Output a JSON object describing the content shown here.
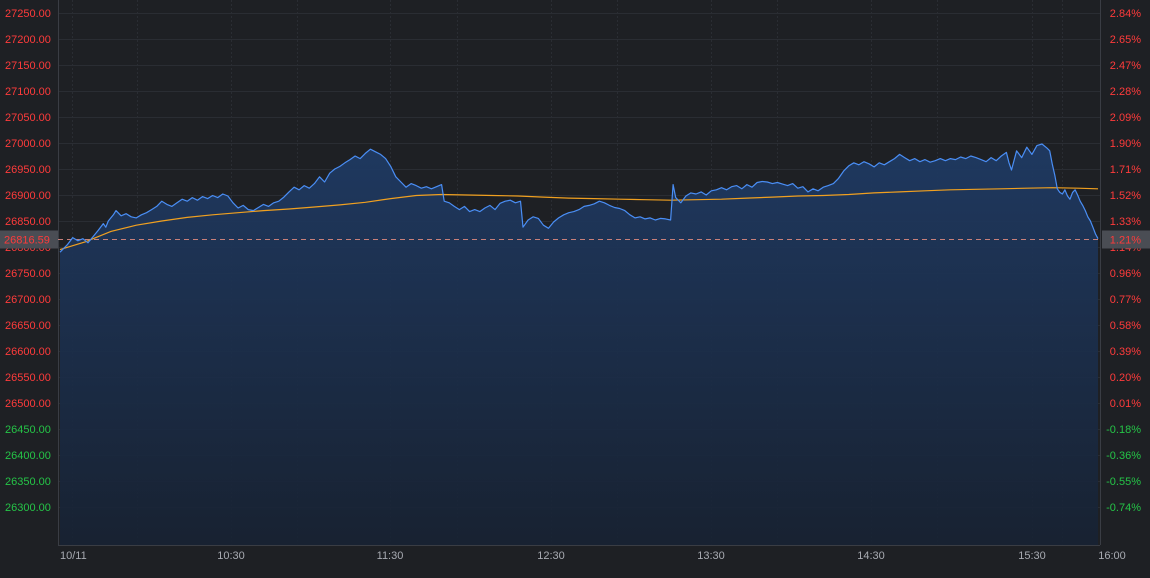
{
  "chart_data": {
    "type": "area",
    "title": "",
    "xlabel": "",
    "ylabel": "",
    "reference_price": 26495.0,
    "last_price_label": "26816.59",
    "last_pct_label": "1.21%",
    "ylim": [
      26250,
      27270
    ],
    "y_ticks_left": [
      "27250.00",
      "27200.00",
      "27150.00",
      "27100.00",
      "27050.00",
      "27000.00",
      "26950.00",
      "26900.00",
      "26850.00",
      "26800.00",
      "26750.00",
      "26700.00",
      "26650.00",
      "26600.00",
      "26550.00",
      "26500.00",
      "26450.00",
      "26400.00",
      "26350.00",
      "26300.00"
    ],
    "y_tick_values": [
      27250,
      27200,
      27150,
      27100,
      27050,
      27000,
      26950,
      26900,
      26850,
      26800,
      26750,
      26700,
      26650,
      26600,
      26550,
      26500,
      26450,
      26400,
      26350,
      26300
    ],
    "y_ticks_right": [
      "2.84%",
      "2.65%",
      "2.47%",
      "2.28%",
      "2.09%",
      "1.90%",
      "1.71%",
      "1.52%",
      "1.33%",
      "1.14%",
      "0.96%",
      "0.77%",
      "0.58%",
      "0.39%",
      "0.20%",
      "0.01%",
      "-0.18%",
      "-0.36%",
      "-0.55%",
      "-0.74%"
    ],
    "x_ticks": [
      {
        "label": "10/11",
        "t": 0
      },
      {
        "label": "10:30",
        "t": 60
      },
      {
        "label": "11:30",
        "t": 120
      },
      {
        "label": "12:30",
        "t": 180
      },
      {
        "label": "13:30",
        "t": 240
      },
      {
        "label": "14:30",
        "t": 300
      },
      {
        "label": "15:30",
        "t": 360
      },
      {
        "label": "16:00",
        "t": 390
      }
    ],
    "x_range": [
      0,
      390
    ],
    "grid": true,
    "colors": {
      "price_line": "#4a8ef5",
      "area_fill": "#1b2f4f",
      "avg_line": "#f0a020",
      "up": "#ff3b3b",
      "down": "#25c447",
      "dashed_ref": "#c8807a"
    },
    "series": [
      {
        "name": "",
        "role": "price",
        "points": [
          [
            0,
            26790
          ],
          [
            3,
            26805
          ],
          [
            5,
            26818
          ],
          [
            7,
            26812
          ],
          [
            9,
            26816
          ],
          [
            11,
            26808
          ],
          [
            13,
            26820
          ],
          [
            15,
            26832
          ],
          [
            17,
            26845
          ],
          [
            18,
            26838
          ],
          [
            19,
            26850
          ],
          [
            21,
            26862
          ],
          [
            22,
            26870
          ],
          [
            24,
            26860
          ],
          [
            26,
            26864
          ],
          [
            28,
            26858
          ],
          [
            30,
            26856
          ],
          [
            32,
            26862
          ],
          [
            34,
            26866
          ],
          [
            36,
            26872
          ],
          [
            38,
            26878
          ],
          [
            40,
            26888
          ],
          [
            42,
            26882
          ],
          [
            44,
            26878
          ],
          [
            46,
            26885
          ],
          [
            48,
            26892
          ],
          [
            50,
            26888
          ],
          [
            52,
            26895
          ],
          [
            54,
            26890
          ],
          [
            56,
            26897
          ],
          [
            58,
            26893
          ],
          [
            60,
            26899
          ],
          [
            62,
            26895
          ],
          [
            64,
            26902
          ],
          [
            66,
            26898
          ],
          [
            68,
            26885
          ],
          [
            70,
            26875
          ],
          [
            72,
            26880
          ],
          [
            74,
            26872
          ],
          [
            76,
            26870
          ],
          [
            78,
            26876
          ],
          [
            80,
            26882
          ],
          [
            82,
            26878
          ],
          [
            84,
            26885
          ],
          [
            86,
            26888
          ],
          [
            88,
            26896
          ],
          [
            90,
            26906
          ],
          [
            92,
            26915
          ],
          [
            94,
            26910
          ],
          [
            96,
            26918
          ],
          [
            98,
            26913
          ],
          [
            100,
            26922
          ],
          [
            102,
            26935
          ],
          [
            104,
            26925
          ],
          [
            106,
            26942
          ],
          [
            108,
            26950
          ],
          [
            110,
            26955
          ],
          [
            112,
            26962
          ],
          [
            114,
            26968
          ],
          [
            116,
            26975
          ],
          [
            118,
            26970
          ],
          [
            120,
            26980
          ],
          [
            122,
            26988
          ],
          [
            124,
            26983
          ],
          [
            126,
            26978
          ],
          [
            128,
            26970
          ],
          [
            130,
            26955
          ],
          [
            132,
            26935
          ],
          [
            134,
            26925
          ],
          [
            136,
            26915
          ],
          [
            138,
            26922
          ],
          [
            140,
            26918
          ],
          [
            142,
            26913
          ],
          [
            144,
            26916
          ],
          [
            146,
            26912
          ],
          [
            148,
            26916
          ],
          [
            150,
            26920
          ],
          [
            151,
            26888
          ],
          [
            153,
            26885
          ],
          [
            155,
            26878
          ],
          [
            157,
            26872
          ],
          [
            159,
            26878
          ],
          [
            161,
            26868
          ],
          [
            163,
            26872
          ],
          [
            165,
            26868
          ],
          [
            167,
            26875
          ],
          [
            169,
            26880
          ],
          [
            171,
            26872
          ],
          [
            173,
            26884
          ],
          [
            175,
            26888
          ],
          [
            177,
            26890
          ],
          [
            179,
            26885
          ],
          [
            181,
            26888
          ],
          [
            182,
            26838
          ],
          [
            184,
            26852
          ],
          [
            186,
            26858
          ],
          [
            188,
            26855
          ],
          [
            190,
            26842
          ],
          [
            192,
            26836
          ],
          [
            194,
            26848
          ],
          [
            196,
            26856
          ],
          [
            198,
            26862
          ],
          [
            200,
            26866
          ],
          [
            202,
            26868
          ],
          [
            204,
            26872
          ],
          [
            206,
            26878
          ],
          [
            208,
            26880
          ],
          [
            210,
            26883
          ],
          [
            212,
            26888
          ],
          [
            214,
            26885
          ],
          [
            216,
            26880
          ],
          [
            218,
            26876
          ],
          [
            220,
            26874
          ],
          [
            222,
            26870
          ],
          [
            224,
            26862
          ],
          [
            226,
            26856
          ],
          [
            228,
            26858
          ],
          [
            230,
            26854
          ],
          [
            232,
            26856
          ],
          [
            234,
            26852
          ],
          [
            236,
            26855
          ],
          [
            238,
            26854
          ],
          [
            240,
            26852
          ],
          [
            241,
            26920
          ],
          [
            242,
            26895
          ],
          [
            244,
            26885
          ],
          [
            246,
            26898
          ],
          [
            248,
            26904
          ],
          [
            250,
            26902
          ],
          [
            252,
            26906
          ],
          [
            254,
            26900
          ],
          [
            256,
            26908
          ],
          [
            258,
            26910
          ],
          [
            260,
            26914
          ],
          [
            262,
            26910
          ],
          [
            264,
            26916
          ],
          [
            266,
            26918
          ],
          [
            268,
            26912
          ],
          [
            270,
            26920
          ],
          [
            272,
            26915
          ],
          [
            274,
            26924
          ],
          [
            276,
            26926
          ],
          [
            278,
            26925
          ],
          [
            280,
            26922
          ],
          [
            282,
            26924
          ],
          [
            284,
            26921
          ],
          [
            286,
            26918
          ],
          [
            288,
            26922
          ],
          [
            290,
            26913
          ],
          [
            292,
            26916
          ],
          [
            294,
            26906
          ],
          [
            296,
            26912
          ],
          [
            298,
            26908
          ],
          [
            300,
            26915
          ],
          [
            302,
            26918
          ],
          [
            304,
            26922
          ],
          [
            306,
            26932
          ],
          [
            308,
            26946
          ],
          [
            310,
            26956
          ],
          [
            312,
            26962
          ],
          [
            314,
            26958
          ],
          [
            316,
            26964
          ],
          [
            318,
            26960
          ],
          [
            320,
            26954
          ],
          [
            322,
            26962
          ],
          [
            324,
            26958
          ],
          [
            326,
            26964
          ],
          [
            328,
            26970
          ],
          [
            330,
            26978
          ],
          [
            332,
            26972
          ],
          [
            334,
            26966
          ],
          [
            336,
            26970
          ],
          [
            338,
            26964
          ],
          [
            340,
            26968
          ],
          [
            342,
            26963
          ],
          [
            344,
            26966
          ],
          [
            346,
            26970
          ],
          [
            348,
            26966
          ],
          [
            350,
            26970
          ],
          [
            352,
            26968
          ],
          [
            354,
            26973
          ],
          [
            356,
            26970
          ],
          [
            358,
            26975
          ],
          [
            360,
            26972
          ],
          [
            362,
            26968
          ],
          [
            364,
            26964
          ],
          [
            366,
            26972
          ],
          [
            368,
            26966
          ],
          [
            370,
            26975
          ],
          [
            372,
            26982
          ],
          [
            373,
            26962
          ],
          [
            374,
            26948
          ],
          [
            376,
            26985
          ],
          [
            378,
            26972
          ],
          [
            380,
            26992
          ],
          [
            382,
            26978
          ],
          [
            384,
            26995
          ],
          [
            386,
            26998
          ],
          [
            388,
            26990
          ],
          [
            389,
            26985
          ],
          [
            390,
            26960
          ],
          [
            391,
            26938
          ],
          [
            392,
            26912
          ],
          [
            393,
            26905
          ],
          [
            394,
            26902
          ],
          [
            395,
            26910
          ],
          [
            396,
            26898
          ],
          [
            397,
            26892
          ],
          [
            398,
            26905
          ],
          [
            399,
            26910
          ],
          [
            400,
            26900
          ],
          [
            401,
            26888
          ],
          [
            402,
            26880
          ],
          [
            403,
            26870
          ],
          [
            404,
            26858
          ],
          [
            405,
            26850
          ],
          [
            406,
            26838
          ],
          [
            407,
            26825
          ],
          [
            408,
            26816
          ]
        ]
      },
      {
        "name": "",
        "role": "average",
        "points": [
          [
            0,
            26795
          ],
          [
            10,
            26810
          ],
          [
            20,
            26830
          ],
          [
            30,
            26842
          ],
          [
            40,
            26850
          ],
          [
            50,
            26857
          ],
          [
            60,
            26862
          ],
          [
            70,
            26866
          ],
          [
            80,
            26870
          ],
          [
            90,
            26873
          ],
          [
            100,
            26877
          ],
          [
            110,
            26881
          ],
          [
            120,
            26886
          ],
          [
            130,
            26893
          ],
          [
            140,
            26899
          ],
          [
            150,
            26901
          ],
          [
            160,
            26900
          ],
          [
            170,
            26899
          ],
          [
            180,
            26898
          ],
          [
            190,
            26896
          ],
          [
            200,
            26894
          ],
          [
            210,
            26893
          ],
          [
            220,
            26892
          ],
          [
            230,
            26891
          ],
          [
            240,
            26890
          ],
          [
            250,
            26891
          ],
          [
            260,
            26892
          ],
          [
            270,
            26894
          ],
          [
            280,
            26896
          ],
          [
            290,
            26898
          ],
          [
            300,
            26899
          ],
          [
            310,
            26901
          ],
          [
            320,
            26904
          ],
          [
            330,
            26906
          ],
          [
            340,
            26908
          ],
          [
            350,
            26910
          ],
          [
            360,
            26911
          ],
          [
            370,
            26912
          ],
          [
            380,
            26913
          ],
          [
            390,
            26914
          ],
          [
            400,
            26913
          ],
          [
            408,
            26912
          ]
        ]
      }
    ]
  }
}
